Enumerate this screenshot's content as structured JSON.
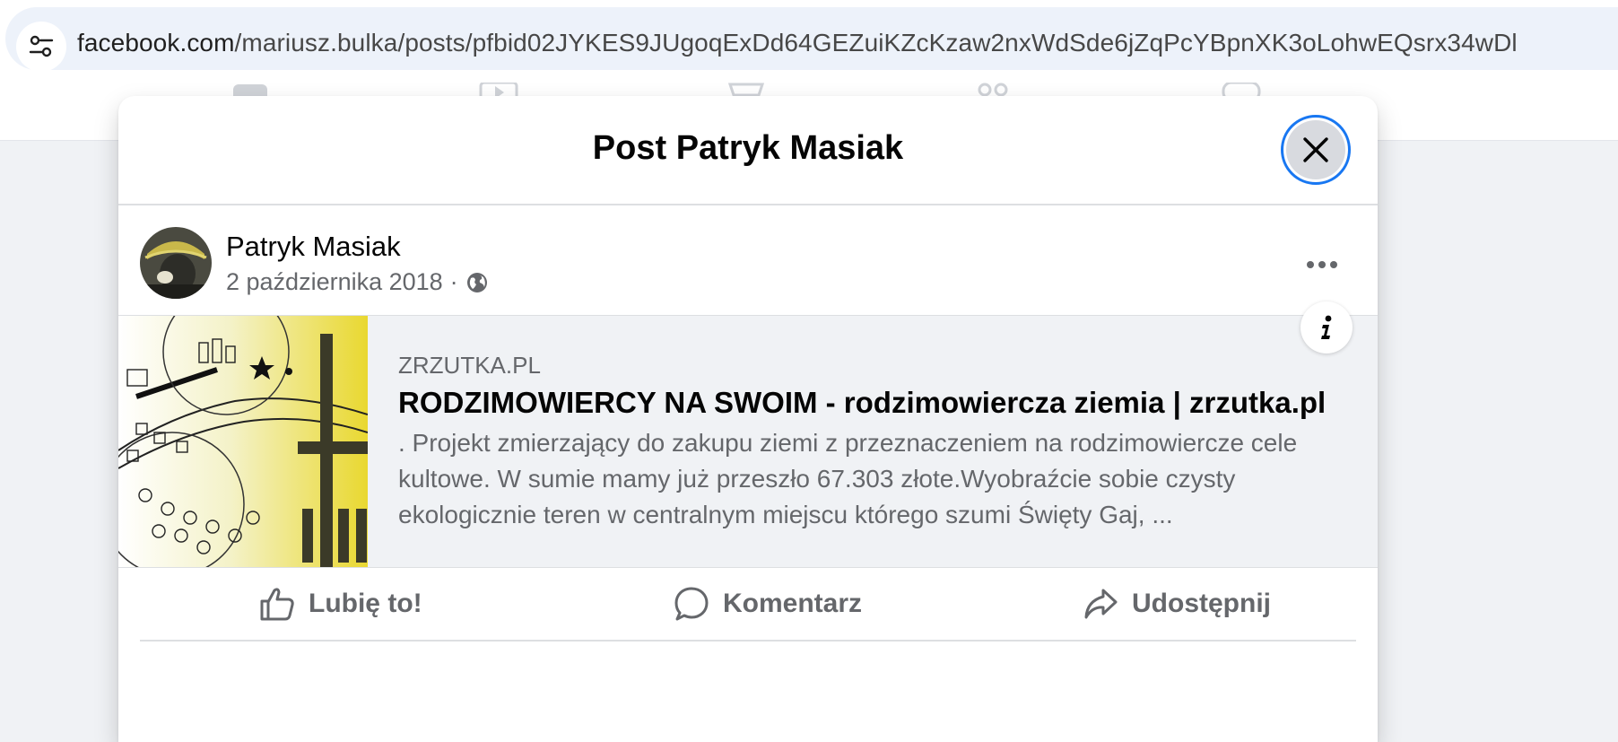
{
  "browser": {
    "url_host": "facebook.com",
    "url_path": "/mariusz.bulka/posts/pfbid02JYKES9JUgoqExDd64GEZuiKZcKzaw2nxWdSde6jZqPcYBpnXK3oLohwEQsrx34wDl",
    "site_info_icon": "tune-icon"
  },
  "modal": {
    "title": "Post Patryk Masiak",
    "close_icon": "close-icon"
  },
  "post": {
    "author": "Patryk Masiak",
    "date": "2 października 2018",
    "separator": "·",
    "audience_icon": "globe-icon",
    "more_icon": "more-horizontal-icon"
  },
  "link_preview": {
    "domain": "ZRZUTKA.PL",
    "title": "RODZIMOWIERCY NA SWOIM - rodzimowiercza ziemia | zrzutka.pl",
    "description": ". Projekt zmierzający do zakupu ziemi z przeznaczeniem na rodzimowiercze cele kultowe. W sumie mamy już przeszło 67.303 złote.Wyobraźcie sobie czysty ekologicznie teren w centralnym miejscu którego szumi Święty Gaj, ...",
    "info_icon": "info-icon"
  },
  "actions": {
    "like": "Lubię to!",
    "comment": "Komentarz",
    "share": "Udostępnij"
  },
  "colors": {
    "accent": "#1877f2",
    "text_primary": "#050505",
    "text_secondary": "#65676b",
    "card_bg": "#f0f2f5"
  }
}
